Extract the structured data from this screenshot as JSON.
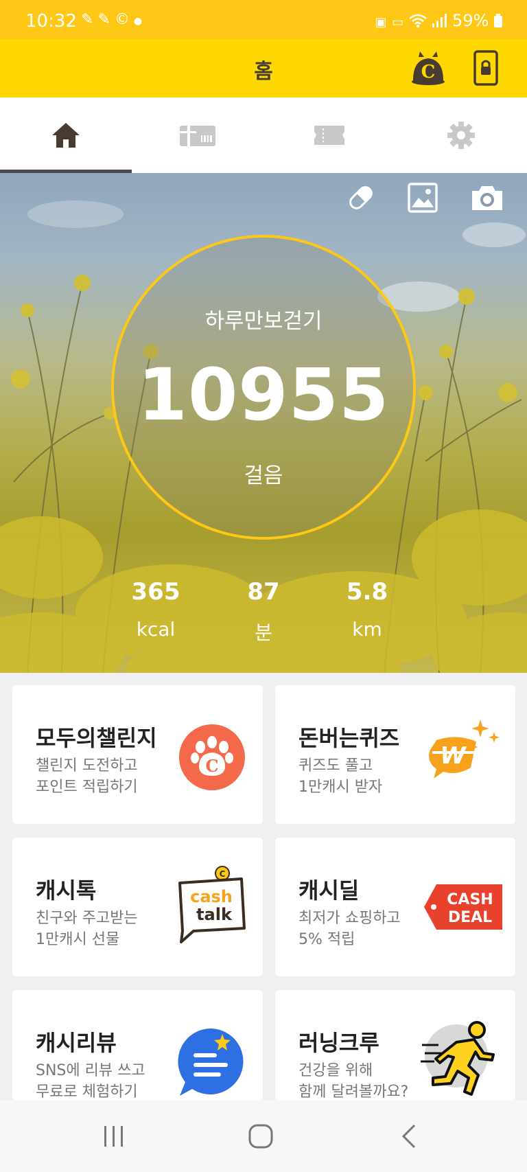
{
  "status_bar": {
    "time": "10:32",
    "battery": "59%",
    "left_icons": [
      "notification-icon",
      "notification-icon",
      "c-circle-icon",
      "dot-icon"
    ],
    "right_icons": [
      "battery-saver-icon",
      "bed-icon",
      "wifi-icon",
      "signal-icon",
      "battery-icon"
    ]
  },
  "app_bar": {
    "title": "홈",
    "actions": [
      "cash-dog-icon",
      "phone-lock-icon"
    ]
  },
  "tabs": [
    {
      "icon": "home-icon",
      "active": true
    },
    {
      "icon": "gift-card-icon",
      "active": false
    },
    {
      "icon": "ticket-icon",
      "active": false
    },
    {
      "icon": "gear-icon",
      "active": false
    }
  ],
  "hero": {
    "tools": [
      "pill-icon",
      "image-icon",
      "camera-icon"
    ],
    "title": "하루만보걷기",
    "steps": "10955",
    "steps_unit": "걸음",
    "stats": [
      {
        "value": "365",
        "unit": "kcal"
      },
      {
        "value": "87",
        "unit": "분"
      },
      {
        "value": "5.8",
        "unit": "km"
      }
    ]
  },
  "cards": [
    {
      "title": "모두의챌린지",
      "line1": "챌린지 도전하고",
      "line2": "포인트 적립하기",
      "icon": "paw-icon"
    },
    {
      "title": "돈버는퀴즈",
      "line1": "퀴즈도 풀고",
      "line2": "1만캐시 받자",
      "icon": "quiz-w-icon"
    },
    {
      "title": "캐시톡",
      "line1": "친구와 주고받는",
      "line2": "1만캐시 선물",
      "icon": "cashtalk-icon",
      "badge": [
        "cash",
        "talk"
      ]
    },
    {
      "title": "캐시딜",
      "line1": "최저가 쇼핑하고",
      "line2": "5% 적립",
      "icon": "cashdeal-icon",
      "badge": [
        "CASH",
        "DEAL"
      ]
    },
    {
      "title": "캐시리뷰",
      "line1": "SNS에 리뷰 쓰고",
      "line2": "무료로 체험하기",
      "icon": "review-chat-icon"
    },
    {
      "title": "러닝크루",
      "line1": "건강을 위해",
      "line2": "함께 달려볼까요?",
      "icon": "runner-icon"
    }
  ],
  "colors": {
    "status_bar": "#ffc816",
    "app_bar": "#ffd800",
    "accent": "#ffc816",
    "paw": "#f3694a",
    "cashdeal": "#e8412c",
    "review": "#2f6fe4"
  },
  "nav_bar": [
    "recent-apps-icon",
    "home-circle-icon",
    "back-icon"
  ]
}
